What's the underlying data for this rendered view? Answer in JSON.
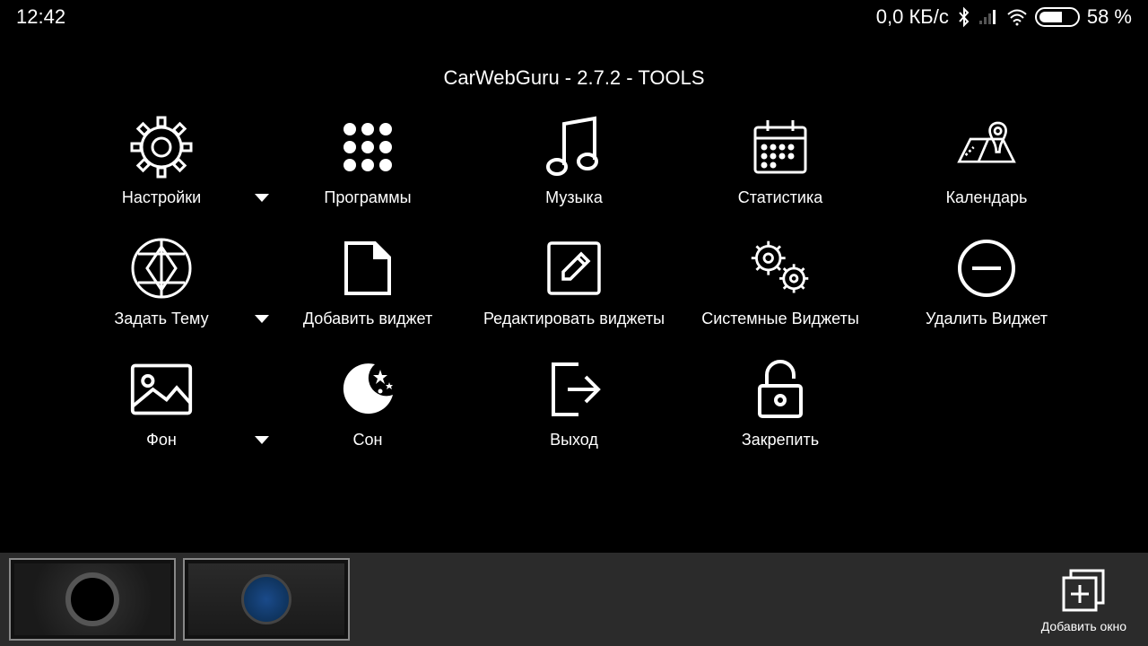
{
  "statusBar": {
    "time": "12:42",
    "dataRate": "0,0 КБ/с",
    "batteryText": "58 %"
  },
  "title": "CarWebGuru - 2.7.2 - TOOLS",
  "items": [
    {
      "name": "settings",
      "label": "Настройки",
      "chevron": true
    },
    {
      "name": "programs",
      "label": "Программы",
      "chevron": false
    },
    {
      "name": "music",
      "label": "Музыка",
      "chevron": false
    },
    {
      "name": "statistics",
      "label": "Статистика",
      "chevron": false
    },
    {
      "name": "calendar",
      "label": "Календарь",
      "chevron": false
    },
    {
      "name": "set-theme",
      "label": "Задать Тему",
      "chevron": true
    },
    {
      "name": "add-widget",
      "label": "Добавить виджет",
      "chevron": false
    },
    {
      "name": "edit-widgets",
      "label": "Редактировать виджеты",
      "chevron": false
    },
    {
      "name": "system-widgets",
      "label": "Системные Виджеты",
      "chevron": false
    },
    {
      "name": "remove-widget",
      "label": "Удалить Виджет",
      "chevron": false
    },
    {
      "name": "background",
      "label": "Фон",
      "chevron": true
    },
    {
      "name": "sleep",
      "label": "Сон",
      "chevron": false
    },
    {
      "name": "exit",
      "label": "Выход",
      "chevron": false
    },
    {
      "name": "pin",
      "label": "Закрепить",
      "chevron": false
    }
  ],
  "bottomBar": {
    "addWindow": "Добавить окно"
  }
}
